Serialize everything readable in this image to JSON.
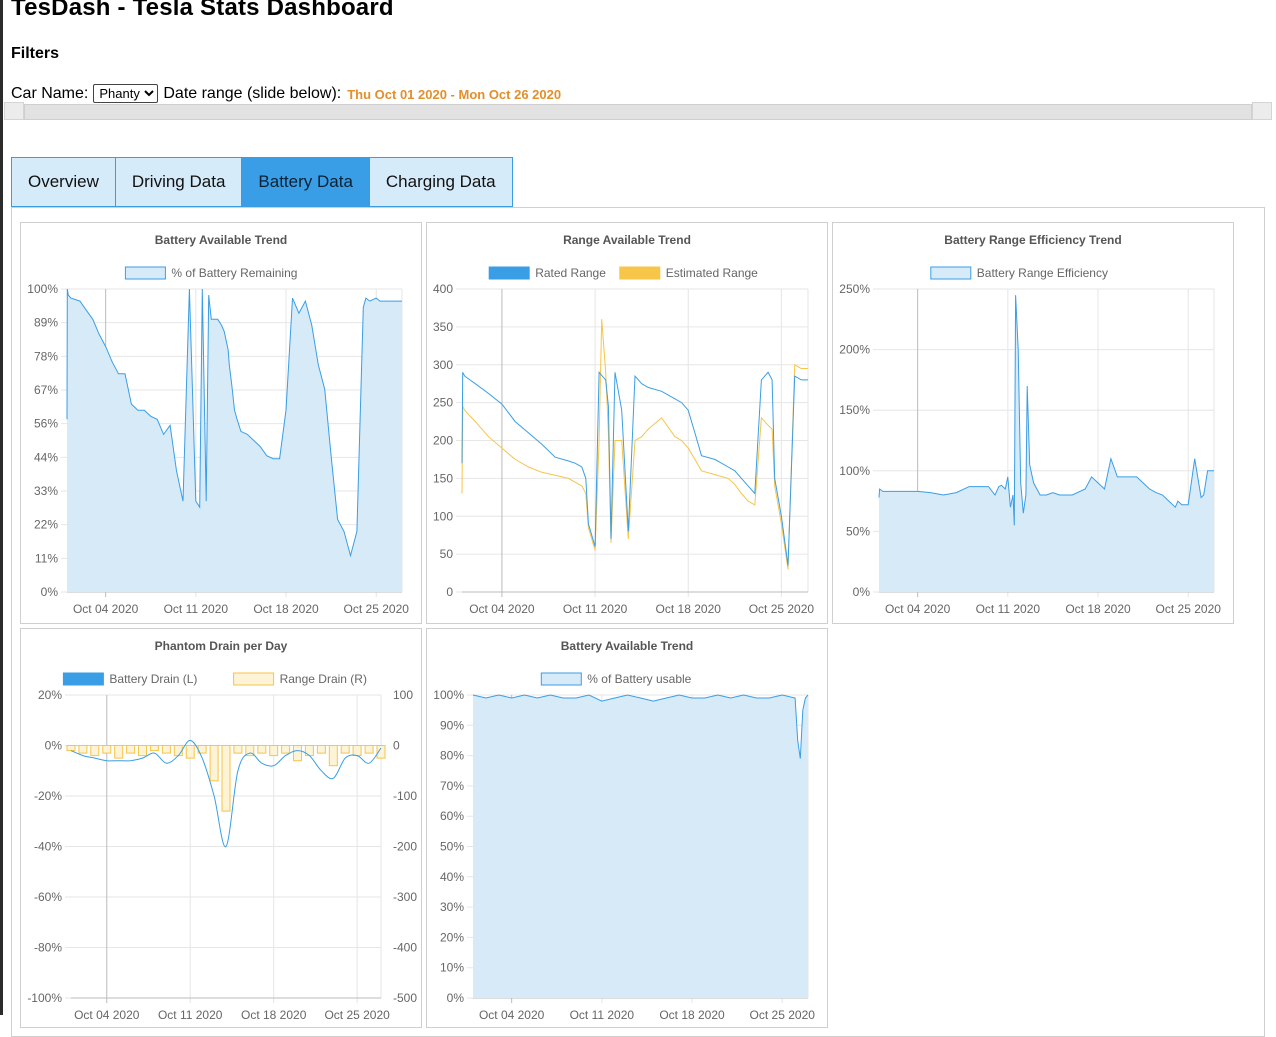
{
  "app": {
    "title": "TesDash - Tesla Stats Dashboard",
    "filters_heading": "Filters",
    "car_label": "Car Name:",
    "car_selected": "Phanty",
    "date_label": "Date range (slide below):",
    "date_range": "Thu Oct 01 2020 - Mon Oct 26 2020"
  },
  "tabs": [
    {
      "label": "Overview",
      "active": false
    },
    {
      "label": "Driving Data",
      "active": false
    },
    {
      "label": "Battery Data",
      "active": true
    },
    {
      "label": "Charging Data",
      "active": false
    }
  ],
  "colors": {
    "blue": "#3a9ee6",
    "blue_fill": "#d6eaf8",
    "yellow": "#f7c548",
    "yellow_fill": "#fdf3d7",
    "accent_orange": "#e38f2a"
  },
  "chart_data": [
    {
      "type": "area",
      "title": "Battery Available Trend",
      "series": [
        {
          "name": "% of Battery Remaining",
          "color": "#3a9ee6",
          "x": [
            0,
            0.02,
            0.1,
            0.3,
            1,
            1.5,
            2,
            2.5,
            3,
            3.5,
            4,
            4.5,
            5,
            5.5,
            6,
            6.5,
            7,
            7.5,
            8,
            8.5,
            9,
            9.5,
            10,
            10.3,
            10.5,
            10.8,
            11,
            11.2,
            11.5,
            11.7,
            12,
            12.2,
            12.5,
            12.6,
            12.8,
            13,
            13.2,
            13.5,
            14,
            14.5,
            15,
            15.5,
            16,
            16.5,
            17,
            17.5,
            18,
            18.5,
            19,
            19.5,
            20,
            20.5,
            21,
            21.5,
            22,
            22.5,
            23,
            23.2,
            23.5,
            24,
            24.3,
            24.5,
            24.7,
            25,
            25.2,
            25.4,
            25.7,
            26
          ],
          "y": [
            57,
            100,
            98,
            97,
            96,
            93,
            90,
            85,
            81,
            76,
            72,
            72,
            62,
            60,
            60,
            58,
            57,
            52,
            55,
            40,
            30,
            100,
            30,
            28,
            100,
            30,
            98,
            90,
            90,
            90,
            88,
            86,
            80,
            75,
            68,
            60,
            57,
            53,
            52,
            50,
            48,
            45,
            44,
            44,
            60,
            97,
            92,
            96,
            88,
            75,
            67,
            45,
            24,
            20,
            12,
            20,
            94,
            97,
            96,
            97,
            96,
            96,
            96,
            96,
            96,
            96,
            96,
            96
          ]
        }
      ],
      "xticks": [
        "Oct 04 2020",
        "Oct 11 2020",
        "Oct 18 2020",
        "Oct 25 2020"
      ],
      "yticks": [
        "0%",
        "11%",
        "22%",
        "33%",
        "44%",
        "56%",
        "67%",
        "78%",
        "89%",
        "100%"
      ],
      "ylim": [
        0,
        100
      ],
      "grid": true,
      "legend": "top"
    },
    {
      "type": "line",
      "title": "Range Available Trend",
      "series": [
        {
          "name": "Rated Range",
          "color": "#3a9ee6",
          "x": [
            0,
            0.05,
            0.2,
            1,
            2,
            3,
            4,
            5,
            6,
            7,
            8,
            8.5,
            9,
            9.3,
            9.5,
            10,
            10.3,
            10.5,
            10.8,
            11,
            11.2,
            11.5,
            12,
            12.5,
            13,
            13.5,
            14,
            15,
            16,
            16.5,
            17,
            17.5,
            18,
            19,
            20,
            20.5,
            21,
            21.5,
            22,
            22.5,
            23,
            23.3,
            23.5,
            24,
            24.5,
            25,
            25.5,
            26
          ],
          "y": [
            170,
            290,
            285,
            275,
            262,
            248,
            225,
            210,
            195,
            178,
            173,
            170,
            165,
            150,
            90,
            60,
            290,
            286,
            280,
            245,
            70,
            290,
            240,
            80,
            285,
            275,
            270,
            265,
            255,
            250,
            240,
            210,
            180,
            175,
            165,
            160,
            150,
            140,
            130,
            280,
            290,
            280,
            150,
            100,
            35,
            285,
            280,
            280
          ]
        },
        {
          "name": "Estimated Range",
          "color": "#f7c548",
          "x": [
            0,
            0.05,
            0.2,
            1,
            2,
            3,
            4,
            5,
            6,
            7,
            8,
            8.5,
            9,
            9.3,
            9.5,
            10,
            10.3,
            10.5,
            10.8,
            11,
            11.2,
            11.5,
            12,
            12.5,
            13,
            13.5,
            14,
            15,
            16,
            16.5,
            17,
            17.5,
            18,
            19,
            20,
            20.5,
            21,
            21.5,
            22,
            22.5,
            23,
            23.3,
            23.5,
            24,
            24.5,
            25,
            25.5,
            26
          ],
          "y": [
            130,
            245,
            240,
            225,
            205,
            190,
            175,
            165,
            158,
            154,
            150,
            145,
            140,
            130,
            85,
            55,
            200,
            360,
            290,
            210,
            65,
            200,
            200,
            70,
            200,
            205,
            215,
            230,
            205,
            200,
            190,
            175,
            160,
            155,
            150,
            142,
            130,
            120,
            115,
            230,
            220,
            215,
            140,
            90,
            30,
            300,
            295,
            295
          ]
        }
      ],
      "xticks": [
        "Oct 04 2020",
        "Oct 11 2020",
        "Oct 18 2020",
        "Oct 25 2020"
      ],
      "yticks": [
        "0",
        "50",
        "100",
        "150",
        "200",
        "250",
        "300",
        "350",
        "400"
      ],
      "ylim": [
        0,
        400
      ],
      "grid": true,
      "legend": "top"
    },
    {
      "type": "area",
      "title": "Battery Range Efficiency Trend",
      "series": [
        {
          "name": "Battery Range Efficiency",
          "color": "#3a9ee6",
          "x": [
            0,
            0.05,
            0.3,
            1,
            2,
            3,
            4,
            5,
            6,
            7,
            7.5,
            8,
            8.5,
            9,
            9.3,
            9.5,
            9.8,
            10,
            10.2,
            10.4,
            10.5,
            10.6,
            10.8,
            11,
            11.2,
            11.4,
            11.5,
            11.7,
            12,
            12.5,
            13,
            13.5,
            14,
            15,
            16,
            16.5,
            17,
            17.5,
            18,
            18.5,
            19,
            19.5,
            20,
            20.5,
            21,
            21.5,
            22,
            22.5,
            23,
            23.2,
            23.5,
            24,
            24.5,
            25,
            25.2,
            25.5,
            26
          ],
          "y": [
            78,
            85,
            83,
            83,
            83,
            83,
            82,
            80,
            82,
            87,
            87,
            87,
            87,
            80,
            87,
            88,
            85,
            95,
            70,
            80,
            55,
            245,
            200,
            90,
            65,
            80,
            170,
            105,
            90,
            80,
            80,
            82,
            80,
            80,
            85,
            95,
            90,
            85,
            110,
            95,
            95,
            95,
            95,
            90,
            85,
            82,
            80,
            75,
            70,
            75,
            72,
            72,
            110,
            78,
            80,
            100,
            100
          ]
        }
      ],
      "xticks": [
        "Oct 04 2020",
        "Oct 11 2020",
        "Oct 18 2020",
        "Oct 25 2020"
      ],
      "yticks": [
        "0%",
        "50%",
        "100%",
        "150%",
        "200%",
        "250%"
      ],
      "ylim": [
        0,
        250
      ],
      "grid": true,
      "legend": "top"
    },
    {
      "type": "bar",
      "title": "Phantom Drain per Day",
      "series": [
        {
          "name": "Battery Drain (L)",
          "color": "#3a9ee6",
          "axis": "left",
          "x": [
            0,
            1,
            2,
            3,
            4,
            5,
            6,
            7,
            8,
            9,
            10,
            11,
            12,
            13,
            14,
            15,
            16,
            17,
            18,
            19,
            20,
            21,
            22,
            23,
            24,
            25,
            26
          ],
          "y": [
            -2,
            -4,
            -5,
            -6,
            -6,
            -6,
            -5,
            -3,
            -7,
            -4,
            2,
            -5,
            -20,
            -40,
            -10,
            -3,
            -7,
            -8,
            -4,
            -2,
            -4,
            -10,
            -13,
            -5,
            -4,
            -7,
            -1
          ]
        },
        {
          "name": "Range Drain (R)",
          "color": "#f7c548",
          "axis": "right",
          "x": [
            0,
            1,
            2,
            3,
            4,
            5,
            6,
            7,
            8,
            9,
            10,
            11,
            12,
            13,
            14,
            15,
            16,
            17,
            18,
            19,
            20,
            21,
            22,
            23,
            24,
            25,
            26
          ],
          "y": [
            -10,
            -15,
            -20,
            -15,
            -25,
            -15,
            -20,
            -10,
            -15,
            -20,
            -25,
            -15,
            -70,
            -130,
            -15,
            -20,
            -15,
            -20,
            -15,
            -30,
            -20,
            -15,
            -40,
            -15,
            -20,
            -15,
            -25
          ]
        }
      ],
      "xticks": [
        "Oct 04 2020",
        "Oct 11 2020",
        "Oct 18 2020",
        "Oct 25 2020"
      ],
      "yticks_left": [
        "20%",
        "0%",
        "-20%",
        "-40%",
        "-60%",
        "-80%",
        "-100%"
      ],
      "yticks_right": [
        "100",
        "0",
        "-100",
        "-200",
        "-300",
        "-400",
        "-500"
      ],
      "ylim_left": [
        -100,
        20
      ],
      "ylim_right": [
        -500,
        100
      ],
      "grid": true,
      "legend": "top"
    },
    {
      "type": "area",
      "title": "Battery Available Trend",
      "series": [
        {
          "name": "% of Battery usable",
          "color": "#3a9ee6",
          "x": [
            0,
            1,
            2,
            3,
            4,
            5,
            6,
            7,
            8,
            9,
            10,
            11,
            12,
            13,
            14,
            15,
            16,
            17,
            18,
            19,
            20,
            21,
            22,
            23,
            24,
            25,
            25.2,
            25.4,
            25.6,
            25.8,
            26
          ],
          "y": [
            100,
            99,
            100,
            99,
            100,
            99,
            100,
            99,
            99,
            100,
            98,
            99,
            100,
            99,
            98,
            99,
            100,
            99,
            99,
            100,
            99,
            100,
            99,
            99,
            100,
            99,
            85,
            79,
            95,
            99,
            100
          ]
        }
      ],
      "xticks": [
        "Oct 04 2020",
        "Oct 11 2020",
        "Oct 18 2020",
        "Oct 25 2020"
      ],
      "yticks": [
        "0%",
        "10%",
        "20%",
        "30%",
        "40%",
        "50%",
        "60%",
        "70%",
        "80%",
        "90%",
        "100%"
      ],
      "ylim": [
        0,
        100
      ],
      "grid": true,
      "legend": "top"
    }
  ]
}
